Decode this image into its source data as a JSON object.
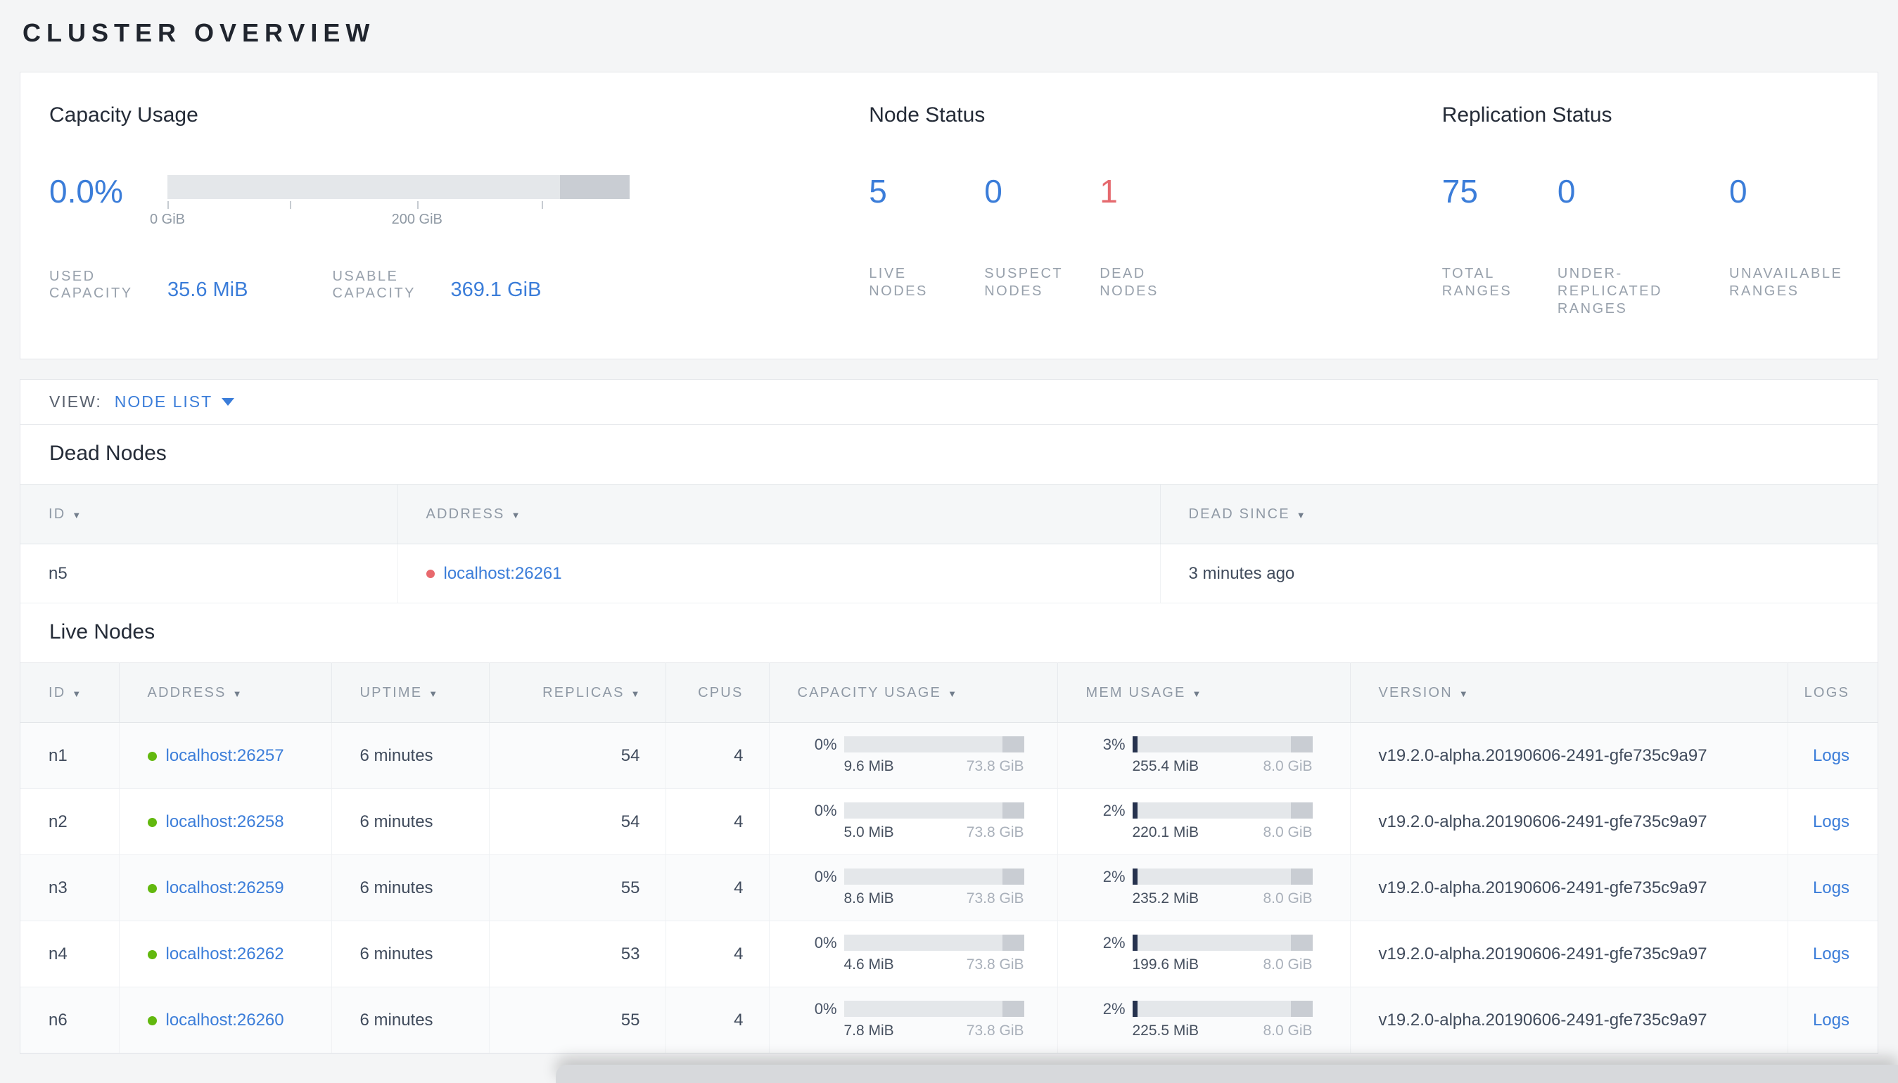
{
  "page": {
    "title": "CLUSTER OVERVIEW"
  },
  "colors": {
    "accent_blue": "#3b7dd9",
    "danger_red": "#e5696e",
    "live_green": "#62b80e",
    "mem_fill_navy": "#26324e",
    "bar_track": "#e4e7ea",
    "bar_endcap": "#c9cdd3"
  },
  "capacity": {
    "title": "Capacity Usage",
    "percent": "0.0%",
    "tick_labels": [
      "0 GiB",
      "200 GiB"
    ],
    "used": {
      "label": "USED CAPACITY",
      "value": "35.6 MiB"
    },
    "usable": {
      "label": "USABLE CAPACITY",
      "value": "369.1 GiB"
    }
  },
  "node_status": {
    "title": "Node Status",
    "items": [
      {
        "value": "5",
        "label": "LIVE NODES"
      },
      {
        "value": "0",
        "label": "SUSPECT NODES"
      },
      {
        "value": "1",
        "label": "DEAD NODES"
      }
    ]
  },
  "replication": {
    "title": "Replication Status",
    "items": [
      {
        "value": "75",
        "label": "TOTAL RANGES"
      },
      {
        "value": "0",
        "label": "UNDER-REPLICATED RANGES"
      },
      {
        "value": "0",
        "label": "UNAVAILABLE RANGES"
      }
    ]
  },
  "view_bar": {
    "label": "VIEW:",
    "selected": "NODE LIST"
  },
  "dead_nodes": {
    "title": "Dead Nodes",
    "columns": [
      "ID",
      "ADDRESS",
      "DEAD SINCE"
    ],
    "rows": [
      {
        "id": "n5",
        "address": "localhost:26261",
        "dead_since": "3 minutes ago"
      }
    ]
  },
  "live_nodes": {
    "title": "Live Nodes",
    "columns": [
      "ID",
      "ADDRESS",
      "UPTIME",
      "REPLICAS",
      "CPUS",
      "CAPACITY USAGE",
      "MEM USAGE",
      "VERSION",
      "LOGS"
    ],
    "rows": [
      {
        "id": "n1",
        "address": "localhost:26257",
        "uptime": "6 minutes",
        "replicas": "54",
        "cpus": "4",
        "cap_pct": "0%",
        "cap_used": "9.6 MiB",
        "cap_total": "73.8 GiB",
        "mem_pct": "3%",
        "mem_used": "255.4 MiB",
        "mem_total": "8.0 GiB",
        "version": "v19.2.0-alpha.20190606-2491-gfe735c9a97",
        "logs": "Logs"
      },
      {
        "id": "n2",
        "address": "localhost:26258",
        "uptime": "6 minutes",
        "replicas": "54",
        "cpus": "4",
        "cap_pct": "0%",
        "cap_used": "5.0 MiB",
        "cap_total": "73.8 GiB",
        "mem_pct": "2%",
        "mem_used": "220.1 MiB",
        "mem_total": "8.0 GiB",
        "version": "v19.2.0-alpha.20190606-2491-gfe735c9a97",
        "logs": "Logs"
      },
      {
        "id": "n3",
        "address": "localhost:26259",
        "uptime": "6 minutes",
        "replicas": "55",
        "cpus": "4",
        "cap_pct": "0%",
        "cap_used": "8.6 MiB",
        "cap_total": "73.8 GiB",
        "mem_pct": "2%",
        "mem_used": "235.2 MiB",
        "mem_total": "8.0 GiB",
        "version": "v19.2.0-alpha.20190606-2491-gfe735c9a97",
        "logs": "Logs"
      },
      {
        "id": "n4",
        "address": "localhost:26262",
        "uptime": "6 minutes",
        "replicas": "53",
        "cpus": "4",
        "cap_pct": "0%",
        "cap_used": "4.6 MiB",
        "cap_total": "73.8 GiB",
        "mem_pct": "2%",
        "mem_used": "199.6 MiB",
        "mem_total": "8.0 GiB",
        "version": "v19.2.0-alpha.20190606-2491-gfe735c9a97",
        "logs": "Logs"
      },
      {
        "id": "n6",
        "address": "localhost:26260",
        "uptime": "6 minutes",
        "replicas": "55",
        "cpus": "4",
        "cap_pct": "0%",
        "cap_used": "7.8 MiB",
        "cap_total": "73.8 GiB",
        "mem_pct": "2%",
        "mem_used": "225.5 MiB",
        "mem_total": "8.0 GiB",
        "version": "v19.2.0-alpha.20190606-2491-gfe735c9a97",
        "logs": "Logs"
      }
    ]
  }
}
